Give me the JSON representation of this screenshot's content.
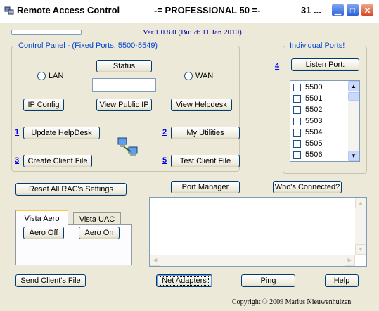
{
  "window": {
    "title_left": "Remote Access Control",
    "title_center": "-= PROFESSIONAL 50 =-",
    "title_right": "31 ..."
  },
  "version": "Ver.1.0.8.0 (Build: 11 Jan 2010)",
  "progress": 0,
  "control_panel": {
    "legend": "Control Panel - (Fixed Ports: 5500-5549)",
    "status_button": "Status",
    "lan_label": "LAN",
    "wan_label": "WAN",
    "status_value": "",
    "ip_config": "IP Config",
    "view_public_ip": "View Public IP",
    "view_helpdesk": "View Helpdesk",
    "link_1": "1",
    "update_helpdesk": "Update HelpDesk",
    "link_2": "2",
    "my_utilities": "My Utilities",
    "link_3": "3",
    "create_client_file": "Create Client File",
    "link_5": "5",
    "test_client_file": "Test Client File",
    "network_icon": "network-computers-icon"
  },
  "ports": {
    "legend": "Individual Ports!",
    "link_4": "4",
    "listen_port": "Listen Port:",
    "items": [
      "5500",
      "5501",
      "5502",
      "5503",
      "5504",
      "5505",
      "5506"
    ]
  },
  "middle": {
    "reset": "Reset All RAC's Settings",
    "port_manager": "Port Manager",
    "whos_connected": "Who's Connected?"
  },
  "tabs": {
    "vista_aero": "Vista Aero",
    "vista_uac": "Vista UAC",
    "aero_off": "Aero Off",
    "aero_on": "Aero On"
  },
  "bottom": {
    "send_client_file": "Send Client's File",
    "net_adapters": "Net Adapters",
    "ping": "Ping",
    "help": "Help",
    "copyright": "Copyright © 2009 Marius Nieuwenhuizen"
  }
}
